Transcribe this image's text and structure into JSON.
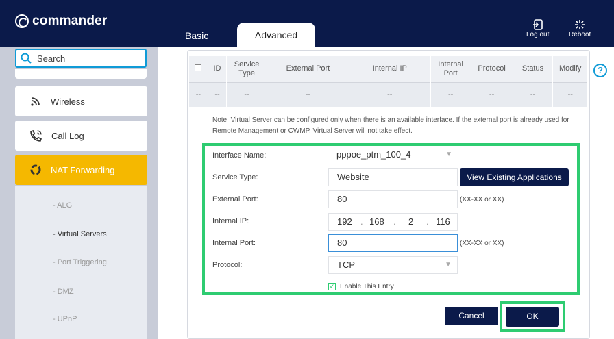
{
  "header": {
    "brand": "commander",
    "tabs": [
      {
        "label": "Basic"
      },
      {
        "label": "Advanced"
      }
    ],
    "logout_label": "Log out",
    "reboot_label": "Reboot"
  },
  "sidebar": {
    "search_placeholder": "Search",
    "items": [
      {
        "label": "Wireless",
        "icon": "wifi-icon"
      },
      {
        "label": "Call Log",
        "icon": "phone-icon"
      },
      {
        "label": "NAT Forwarding",
        "icon": "nat-icon",
        "active": true
      }
    ],
    "subitems": [
      "- ALG",
      "- Virtual Servers",
      "- Port Triggering",
      "- DMZ",
      "- UPnP"
    ]
  },
  "table": {
    "headers": [
      "ID",
      "Service Type",
      "External Port",
      "Internal IP",
      "Internal Port",
      "Protocol",
      "Status",
      "Modify"
    ],
    "empty_cell": "--"
  },
  "note": "Note: Virtual Server can be configured only when there is an available interface. If the external port is already used for Remote Management or CWMP, Virtual Server will not take effect.",
  "form": {
    "interface_label": "Interface Name:",
    "interface_value": "pppoe_ptm_100_4",
    "service_type_label": "Service Type:",
    "service_type_value": "Website",
    "view_apps_label": "View Existing Applications",
    "external_port_label": "External Port:",
    "external_port_value": "80",
    "port_hint": "(XX-XX or XX)",
    "internal_ip_label": "Internal IP:",
    "ip_octets": [
      "192",
      "168",
      "2",
      "116"
    ],
    "internal_port_label": "Internal Port:",
    "internal_port_value": "80",
    "protocol_label": "Protocol:",
    "protocol_value": "TCP",
    "enable_label": "Enable This Entry"
  },
  "actions": {
    "cancel_label": "Cancel",
    "ok_label": "OK"
  },
  "colors": {
    "navy": "#0b1a4a",
    "accent_yellow": "#f5b800",
    "highlight_green": "#2ecc71",
    "link_blue": "#0f9bd7"
  }
}
